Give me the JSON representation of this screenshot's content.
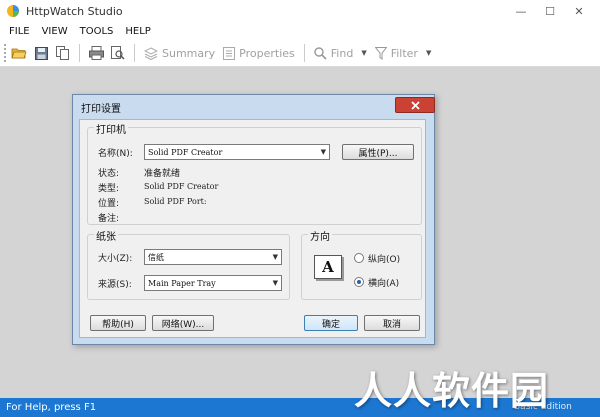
{
  "window": {
    "title": "HttpWatch Studio",
    "controls": {
      "minimize": "—",
      "maximize": "☐",
      "close": "✕"
    }
  },
  "menu": [
    "FILE",
    "VIEW",
    "TOOLS",
    "HELP"
  ],
  "toolbar": {
    "icons": [
      "open-folder-icon",
      "save-icon",
      "copy-icon",
      "print-icon",
      "print-preview-icon"
    ],
    "summary_label": "Summary",
    "properties_label": "Properties",
    "find_label": "Find",
    "filter_label": "Filter",
    "caret": "▼"
  },
  "dialog": {
    "title": "打印设置",
    "printer_group": {
      "title": "打印机",
      "name_label": "名称(N):",
      "name_value": "Solid PDF Creator",
      "properties_button": "属性(P)...",
      "status_label": "状态:",
      "status_value": "准备就绪",
      "type_label": "类型:",
      "type_value": "Solid PDF Creator",
      "location_label": "位置:",
      "location_value": "Solid PDF Port:",
      "comment_label": "备注:",
      "comment_value": ""
    },
    "paper_group": {
      "title": "纸张",
      "size_label": "大小(Z):",
      "size_value": "信纸",
      "source_label": "来源(S):",
      "source_value": "Main Paper Tray"
    },
    "orientation_group": {
      "title": "方向",
      "preview_glyph": "A",
      "portrait_label": "纵向(O)",
      "landscape_label": "横向(A)",
      "selected": "landscape"
    },
    "buttons": {
      "help": "帮助(H)",
      "network": "网络(W)...",
      "ok": "确定",
      "cancel": "取消"
    },
    "dropdown_arrow": "▼"
  },
  "status": {
    "left": "For Help, press F1",
    "right": "Basic Edition"
  },
  "watermark": "人人软件园",
  "colors": {
    "statusbar": "#1c77d2",
    "dialog_frame": "#c9dcef",
    "close_button": "#c94234",
    "client_area": "#d4d4d4"
  }
}
